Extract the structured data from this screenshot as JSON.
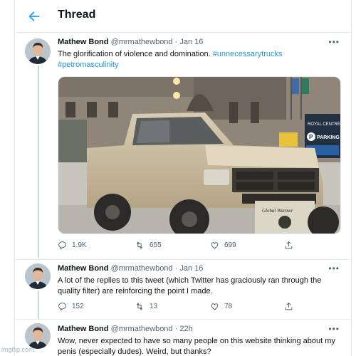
{
  "header": {
    "title": "Thread",
    "back_icon": "arrow-left-icon"
  },
  "tweets": [
    {
      "name": "Mathew Bond",
      "handle": "@mrmathewbond",
      "sep": " · ",
      "time": "Jan 16",
      "more": "•••",
      "text_plain": "The glorification of violence and domination. ",
      "tag1": "#unnecessarytrucks",
      "tag2": "#petromasculinity",
      "media_texts": {
        "sign1": "ROYAL CENTRE",
        "sign2": "PARKING",
        "plate": "Global Warmer"
      },
      "replies": "1.9K",
      "retweets": "655",
      "likes": "699"
    },
    {
      "name": "Mathew Bond",
      "handle": "@mrmathewbond",
      "sep": " · ",
      "time": "Jan 16",
      "more": "•••",
      "text": "A lot of the replies to this tweet (which Twitter has graciously ran through the quality filter) are reinforcing the point I made.",
      "replies": "152",
      "retweets": "13",
      "likes": "78"
    },
    {
      "name": "Mathew Bond",
      "handle": "@mrmathewbond",
      "sep": " · ",
      "time": "22h",
      "more": "•••",
      "text": "Wow, never expected to have so many people on this website thinking about my penis (especially dudes). Weird, but thanks?"
    }
  ],
  "watermark": "imgflip.com",
  "colors": {
    "accent": "#1da1f2",
    "link": "#1b95e0",
    "muted": "#536471",
    "border": "#e6ecf0"
  }
}
